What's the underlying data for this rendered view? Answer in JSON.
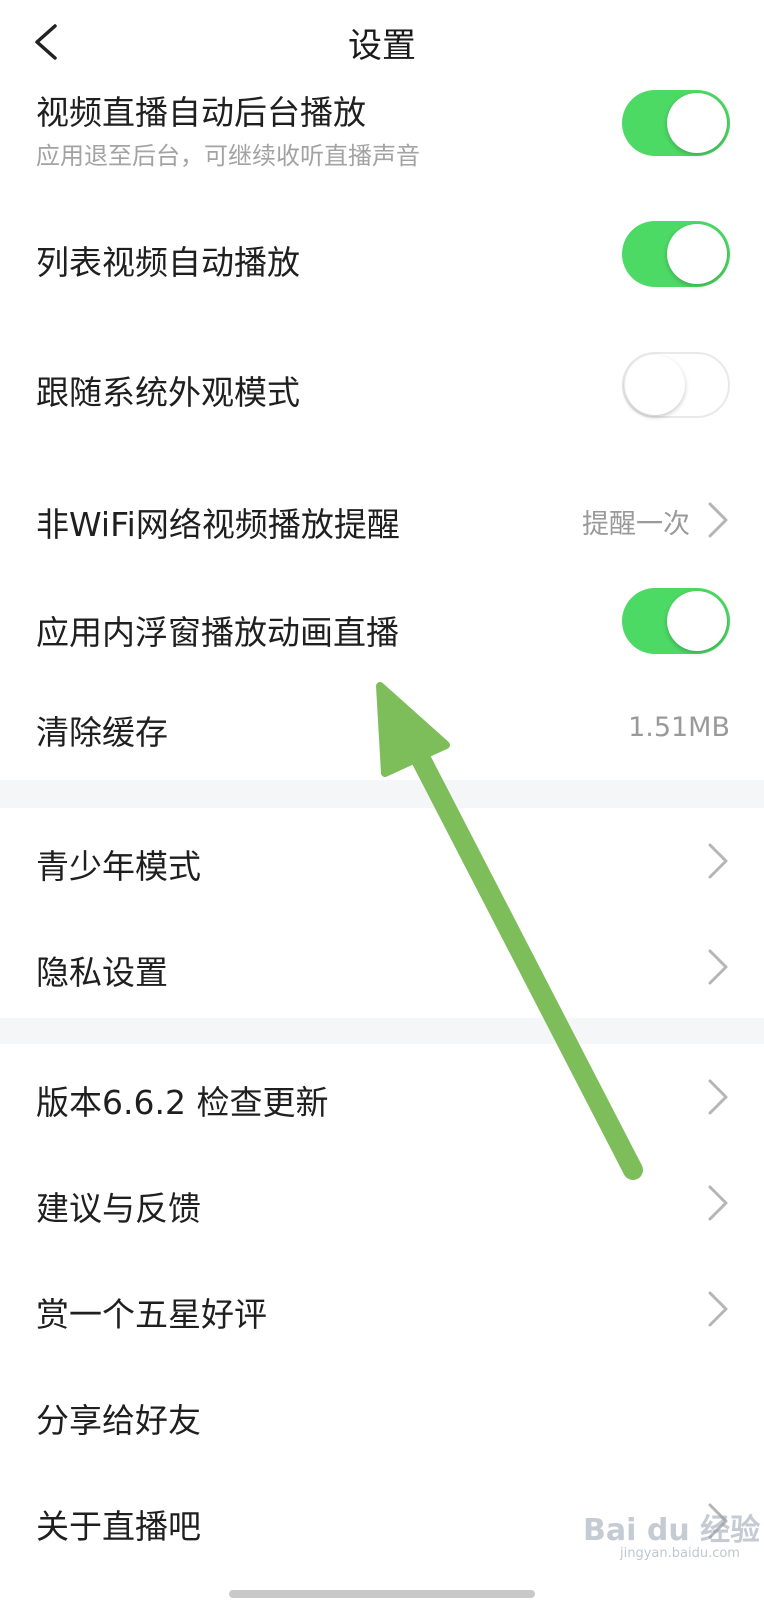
{
  "nav": {
    "title": "设置",
    "back_icon": "chevron-left-icon"
  },
  "settings": {
    "live_background": {
      "title": "视频直播自动后台播放",
      "subtitle": "应用退至后台，可继续收听直播声音",
      "toggle": "on"
    },
    "list_autoplay": {
      "title": "列表视频自动播放",
      "toggle": "on"
    },
    "follow_system_theme": {
      "title": "跟随系统外观模式",
      "toggle": "off"
    },
    "non_wifi_reminder": {
      "title": "非WiFi网络视频播放提醒",
      "value": "提醒一次"
    },
    "in_app_float": {
      "title": "应用内浮窗播放动画直播",
      "toggle": "on"
    },
    "clear_cache": {
      "title": "清除缓存",
      "value": "1.51MB"
    },
    "youth_mode": {
      "title": "青少年模式"
    },
    "privacy": {
      "title": "隐私设置"
    },
    "version": {
      "title": "版本6.6.2  检查更新"
    },
    "feedback": {
      "title": "建议与反馈"
    },
    "rate": {
      "title": "赏一个五星好评"
    },
    "share": {
      "title": "分享给好友"
    },
    "about": {
      "title": "关于直播吧"
    }
  },
  "watermark": {
    "text": "Bai du 经验",
    "sub": "jingyan.baidu.com"
  },
  "colors": {
    "toggle_on": "#4cd964",
    "annotation_arrow": "#7dbd5a",
    "section_gap": "#f5f6f7"
  }
}
